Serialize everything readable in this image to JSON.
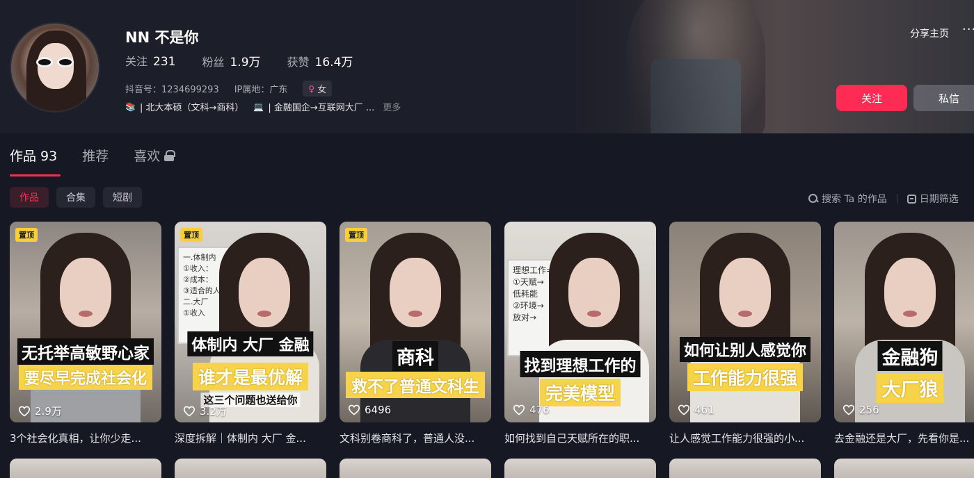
{
  "profile": {
    "nickname": "NN 不是你",
    "stats": [
      {
        "label": "关注",
        "value": "231"
      },
      {
        "label": "粉丝",
        "value": "1.9万"
      },
      {
        "label": "获赞",
        "value": "16.4万"
      }
    ],
    "douyin_id": "抖音号：1234699293",
    "ip_location": "IP属地：广东",
    "gender": "女",
    "bio_emoji_1": "📚",
    "bio_part_1": "| 北大本硕（文科→商科）",
    "bio_emoji_2": "💻",
    "bio_part_2": "| 金融国企→互联网大厂 ...",
    "bio_more": "更多"
  },
  "header_actions": {
    "share": "分享主页",
    "more": "···",
    "follow": "关注",
    "message": "私信"
  },
  "tabs": [
    {
      "label": "作品 93"
    },
    {
      "label": "推荐"
    },
    {
      "label": "喜欢"
    }
  ],
  "subtabs": [
    {
      "label": "作品"
    },
    {
      "label": "合集"
    },
    {
      "label": "短剧"
    }
  ],
  "tools": {
    "search": "搜索 Ta 的作品",
    "date_filter": "日期筛选"
  },
  "videos": [
    {
      "pinned": "置顶",
      "caption1": "无托举高敏野心家",
      "caption2": "要尽早完成社会化",
      "caption_sub": "",
      "likes": "2.9万",
      "title": "3个社会化真相，让你少走..."
    },
    {
      "pinned": "置顶",
      "caption1": "体制内 大厂 金融",
      "caption2": "谁才是最优解",
      "caption_sub": "这三个问题也送给你",
      "likes": "3.2万",
      "title": "深度拆解｜体制内 大厂 金..."
    },
    {
      "pinned": "置顶",
      "caption1": "商科",
      "caption2": "救不了普通文科生",
      "caption_sub": "",
      "likes": "6496",
      "title": "文科别卷商科了，普通人没..."
    },
    {
      "pinned": "",
      "caption1": "找到理想工作的",
      "caption2": "完美模型",
      "caption_sub": "",
      "likes": "476",
      "title": "如何找到自己天赋所在的职..."
    },
    {
      "pinned": "",
      "caption1": "如何让别人感觉你",
      "caption2": "工作能力很强",
      "caption_sub": "",
      "likes": "461",
      "title": "让人感觉工作能力很强的小..."
    },
    {
      "pinned": "",
      "caption1": "金融狗",
      "caption2": "大厂狼",
      "caption_sub": "",
      "likes": "256",
      "title": "去金融还是大厂，先看你是..."
    }
  ],
  "whiteboard_1": "一.体制内\n①收入：\n②成本：\n③适合的人\n二.大厂\n①收入",
  "whiteboard_2": "理想工作=\n①天赋→\n低耗能\n②环境→\n放对→",
  "colors": {
    "accent": "#fe2c55",
    "background": "#161823",
    "pin_badge": "#facd3c",
    "caption_yellow": "#f6d34a"
  }
}
